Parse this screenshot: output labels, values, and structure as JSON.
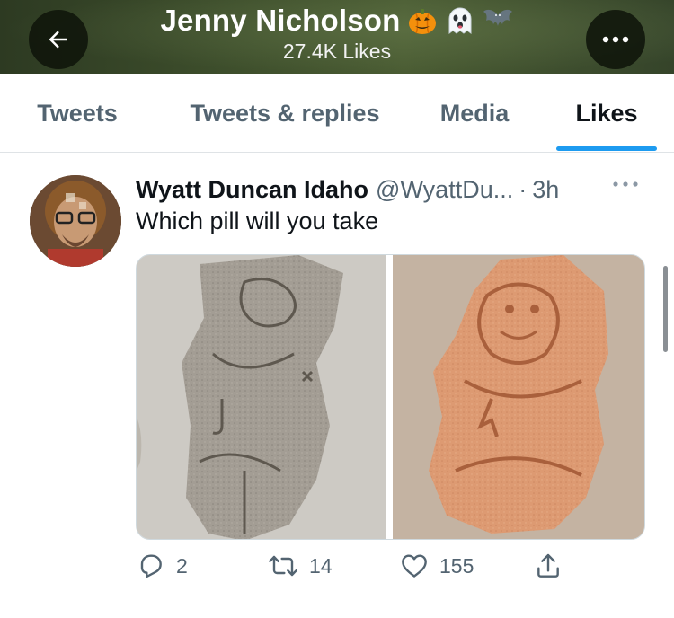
{
  "header": {
    "name": "Jenny Nicholson",
    "emojis": [
      "pumpkin-emoji",
      "ghost-emoji",
      "bat-emoji"
    ],
    "subtitle": "27.4K Likes"
  },
  "tabs": [
    {
      "label": "Tweets",
      "active": false
    },
    {
      "label": "Tweets & replies",
      "active": false
    },
    {
      "label": "Media",
      "active": false
    },
    {
      "label": "Likes",
      "active": true
    }
  ],
  "tweet": {
    "author_name": "Wyatt Duncan Idaho",
    "author_handle": "@WyattDu...",
    "separator": "·",
    "time": "3h",
    "text": "Which pill will you take",
    "stats": {
      "replies": "2",
      "retweets": "14",
      "likes": "155"
    }
  },
  "colors": {
    "accent": "#1d9bf0",
    "muted": "#536471",
    "text": "#0f1419"
  }
}
